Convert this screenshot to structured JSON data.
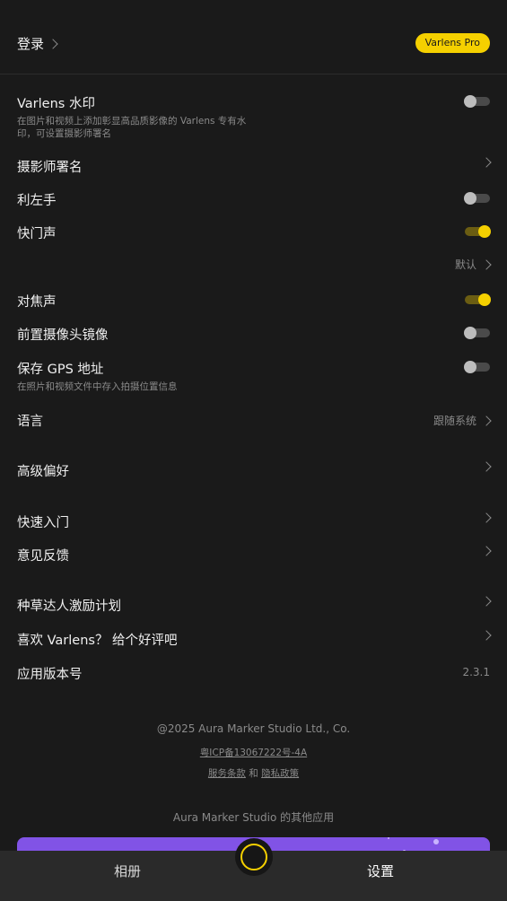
{
  "header": {
    "login_label": "登录",
    "pro_badge": "Varlens Pro"
  },
  "settings": {
    "watermark": {
      "label": "Varlens 水印",
      "desc": "在图片和视频上添加彰显高品质影像的 Varlens 专有水印，可设置摄影师署名",
      "enabled": false
    },
    "photographer": {
      "label": "摄影师署名"
    },
    "left_hand": {
      "label": "利左手",
      "enabled": false
    },
    "shutter_sound": {
      "label": "快门声",
      "enabled": true
    },
    "shutter_sound_option": {
      "value": "默认"
    },
    "focus_sound": {
      "label": "对焦声",
      "enabled": true
    },
    "front_mirror": {
      "label": "前置摄像头镜像",
      "enabled": false
    },
    "gps": {
      "label": "保存 GPS 地址",
      "desc": "在照片和视频文件中存入拍摄位置信息",
      "enabled": false
    },
    "language": {
      "label": "语言",
      "value": "跟随系统"
    },
    "advanced": {
      "label": "高级偏好"
    },
    "quick_start": {
      "label": "快速入门"
    },
    "feedback": {
      "label": "意见反馈"
    },
    "creator_plan": {
      "label": "种草达人激励计划"
    },
    "rate": {
      "label": "喜欢 Varlens？ 给个好评吧"
    },
    "version": {
      "label": "应用版本号",
      "value": "2.3.1"
    }
  },
  "footer": {
    "copyright": "@2025 Aura Marker Studio Ltd., Co.",
    "icp": "粤ICP备13067222号-4A",
    "terms": "服务条款",
    "and": "和",
    "privacy": "隐私政策",
    "other_apps": "Aura Marker Studio 的其他应用"
  },
  "tabbar": {
    "album": "相册",
    "settings": "设置"
  },
  "colors": {
    "accent": "#f5d000",
    "background": "#1a1a1a",
    "promo": "#8153e6"
  },
  "icons": {
    "chevron": "chevron-right-icon",
    "shutter": "shutter-button-icon"
  }
}
